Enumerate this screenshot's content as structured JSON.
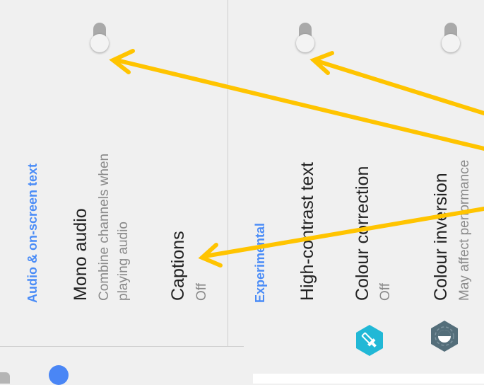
{
  "left_column": {
    "section_title": "Audio & on-screen text",
    "mono_audio": {
      "title": "Mono audio",
      "subtitle_line1": "Combine channels when",
      "subtitle_line2": "playing audio",
      "toggle_state": "off"
    },
    "captions": {
      "title": "Captions",
      "subtitle": "Off"
    }
  },
  "right_column": {
    "section_title": "Experimental",
    "high_contrast": {
      "title": "High-contrast text",
      "toggle_state": "off"
    },
    "colour_correction": {
      "title": "Colour correction",
      "subtitle": "Off",
      "icon": "eyedropper-icon"
    },
    "colour_inversion": {
      "title": "Colour inversion",
      "subtitle": "May affect performance",
      "icon": "invert-icon",
      "toggle_state": "off"
    }
  },
  "colors": {
    "accent": "#4a8cf7",
    "annotation_arrow": "#ffc400",
    "eyedropper_bg": "#21b8d6",
    "invert_bg": "#546e7a"
  }
}
